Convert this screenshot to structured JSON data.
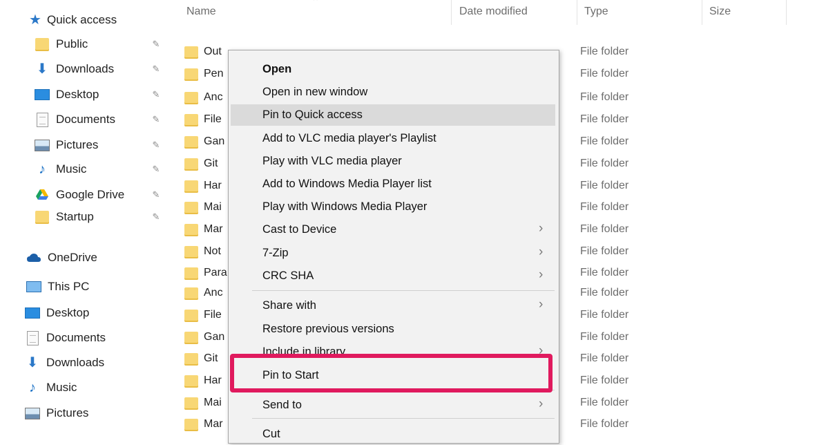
{
  "navigation": {
    "quick_access": "Quick access",
    "pinned": [
      {
        "label": "Public",
        "icon": "folder-icon"
      },
      {
        "label": "Downloads",
        "icon": "download-icon"
      },
      {
        "label": "Desktop",
        "icon": "desktop-icon"
      },
      {
        "label": "Documents",
        "icon": "documents-icon"
      },
      {
        "label": "Pictures",
        "icon": "pictures-icon"
      },
      {
        "label": "Music",
        "icon": "music-icon"
      },
      {
        "label": "Google Drive",
        "icon": "google-drive-icon"
      },
      {
        "label": "Startup",
        "icon": "folder-icon"
      }
    ],
    "onedrive": "OneDrive",
    "this_pc": "This PC",
    "pc_items": [
      {
        "label": "Desktop",
        "icon": "desktop-icon"
      },
      {
        "label": "Documents",
        "icon": "documents-icon"
      },
      {
        "label": "Downloads",
        "icon": "download-icon"
      },
      {
        "label": "Music",
        "icon": "music-icon"
      },
      {
        "label": "Pictures",
        "icon": "pictures-icon"
      }
    ]
  },
  "file_list": {
    "columns": {
      "name": "Name",
      "date_modified": "Date modified",
      "type": "Type",
      "size": "Size"
    },
    "rows": [
      {
        "name": "Out",
        "type": "File folder"
      },
      {
        "name": "Pen",
        "type": "File folder"
      },
      {
        "name": "Anc",
        "type": "File folder"
      },
      {
        "name": "File",
        "type": "File folder"
      },
      {
        "name": "Gan",
        "type": "File folder"
      },
      {
        "name": "Git",
        "type": "File folder"
      },
      {
        "name": "Har",
        "type": "File folder"
      },
      {
        "name": "Mai",
        "type": "File folder"
      },
      {
        "name": "Mar",
        "type": "File folder"
      },
      {
        "name": "Not",
        "type": "File folder"
      },
      {
        "name": "Para",
        "type": "File folder"
      },
      {
        "name": "Anc",
        "type": "File folder"
      },
      {
        "name": "File",
        "type": "File folder"
      },
      {
        "name": "Gan",
        "type": "File folder"
      },
      {
        "name": "Git",
        "type": "File folder"
      },
      {
        "name": "Har",
        "type": "File folder"
      },
      {
        "name": "Mai",
        "type": "File folder"
      },
      {
        "name": "Mar",
        "type": "File folder"
      }
    ]
  },
  "context_menu": {
    "items": [
      {
        "label": "Open",
        "bold": true
      },
      {
        "label": "Open in new window"
      },
      {
        "label": "Pin to Quick access",
        "highlighted": true
      },
      {
        "label": "Add to VLC media player's Playlist"
      },
      {
        "label": "Play with VLC media player"
      },
      {
        "label": "Add to Windows Media Player list"
      },
      {
        "label": "Play with Windows Media Player"
      },
      {
        "label": "Cast to Device",
        "submenu": true
      },
      {
        "label": "7-Zip",
        "submenu": true
      },
      {
        "label": "CRC SHA",
        "submenu": true
      },
      {
        "label": "Share with",
        "submenu": true
      },
      {
        "label": "Restore previous versions"
      },
      {
        "label": "Include in library",
        "submenu": true
      },
      {
        "label": "Pin to Start"
      },
      {
        "label": "Send to",
        "submenu": true
      },
      {
        "label": "Cut"
      }
    ],
    "callout_color": "#e01a5e"
  }
}
